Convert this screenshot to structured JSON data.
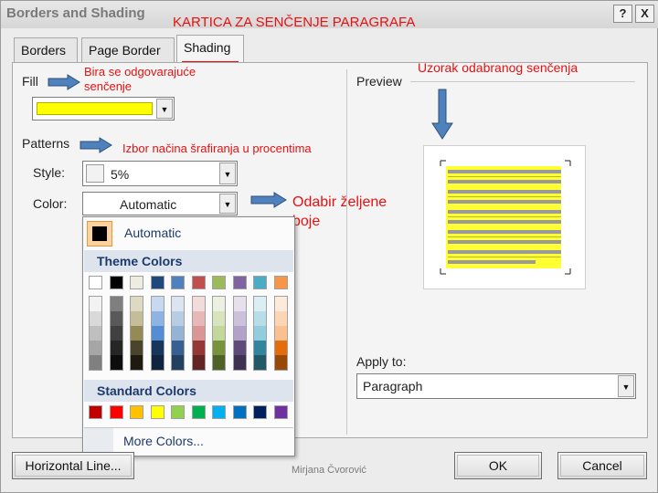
{
  "window": {
    "title": "Borders and Shading",
    "help_button": "?",
    "close_button": "X"
  },
  "annotations": {
    "heading": "KARTICA ZA SENČENJE PARAGRAFA",
    "fill_note": "Bira se odgovarajuće senčenje",
    "patterns_note": "Izbor načina šrafiranja u procentima",
    "color_note": "Odabir željene boje",
    "preview_note": "Uzorak odabranog senčenja",
    "author": "Mirjana Čvorović"
  },
  "tabs": [
    {
      "label": "Borders",
      "active": false
    },
    {
      "label": "Page Border",
      "active": false
    },
    {
      "label": "Shading",
      "active": true
    }
  ],
  "fill": {
    "label": "Fill",
    "value_color": "#ffff00"
  },
  "patterns": {
    "label": "Patterns",
    "style_label": "Style:",
    "style_value": "5%",
    "color_label": "Color:",
    "color_value": "Automatic"
  },
  "preview": {
    "label": "Preview"
  },
  "apply_to": {
    "label": "Apply to:",
    "value": "Paragraph"
  },
  "color_menu": {
    "automatic_label": "Automatic",
    "theme_heading": "Theme Colors",
    "standard_heading": "Standard Colors",
    "more_colors": "More Colors...",
    "theme_colors": [
      [
        "#ffffff",
        "#f2f2f2",
        "#d9d9d9",
        "#bfbfbf",
        "#a6a6a6",
        "#808080"
      ],
      [
        "#000000",
        "#7f7f7f",
        "#595959",
        "#404040",
        "#262626",
        "#0d0d0d"
      ],
      [
        "#eeece1",
        "#ddd9c3",
        "#c4bd97",
        "#948a54",
        "#4a452a",
        "#1d1b10"
      ],
      [
        "#1f497d",
        "#c6d9f1",
        "#8eb4e3",
        "#548dd4",
        "#17365d",
        "#0f243e"
      ],
      [
        "#4f81bd",
        "#dbe5f1",
        "#b8cce4",
        "#95b3d7",
        "#366092",
        "#244061"
      ],
      [
        "#c0504d",
        "#f2dcdb",
        "#e6b9b8",
        "#d99694",
        "#953735",
        "#632523"
      ],
      [
        "#9bbb59",
        "#ebf1de",
        "#d7e4bd",
        "#c3d69b",
        "#77933c",
        "#4f6228"
      ],
      [
        "#8064a2",
        "#e5e0ec",
        "#ccc1da",
        "#b3a2c7",
        "#60497b",
        "#3f3151"
      ],
      [
        "#4bacc6",
        "#dbeef4",
        "#b7dee8",
        "#93cddd",
        "#31859c",
        "#215968"
      ],
      [
        "#f79646",
        "#fdeada",
        "#fcd5b5",
        "#fac090",
        "#e46c0a",
        "#984807"
      ]
    ],
    "standard_colors": [
      "#c00000",
      "#ff0000",
      "#ffc000",
      "#ffff00",
      "#92d050",
      "#00b050",
      "#00b0f0",
      "#0070c0",
      "#002060",
      "#7030a0"
    ]
  },
  "footer": {
    "horizontal_line": "Horizontal Line...",
    "ok": "OK",
    "cancel": "Cancel"
  }
}
